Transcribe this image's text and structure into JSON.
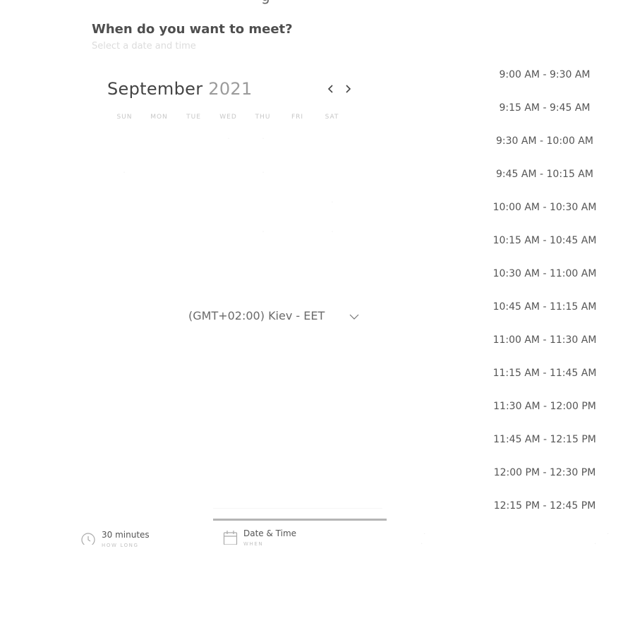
{
  "header": {
    "title": "When do you want to meet?",
    "subtitle": "Select a date and time"
  },
  "calendar": {
    "month": "September",
    "year": "2021",
    "weekdays": [
      "SUN",
      "MON",
      "TUE",
      "WED",
      "THU",
      "FRI",
      "SAT"
    ]
  },
  "timezone": {
    "label": "(GMT+02:00) Kiev - EET"
  },
  "slots": [
    "9:00 AM - 9:30 AM",
    "9:15 AM - 9:45 AM",
    "9:30 AM - 10:00 AM",
    "9:45 AM - 10:15 AM",
    "10:00 AM - 10:30 AM",
    "10:15 AM - 10:45 AM",
    "10:30 AM - 11:00 AM",
    "10:45 AM - 11:15 AM",
    "11:00 AM - 11:30 AM",
    "11:15 AM - 11:45 AM",
    "11:30 AM - 12:00 PM",
    "11:45 AM - 12:15 PM",
    "12:00 PM - 12:30 PM",
    "12:15 PM - 12:45 PM"
  ],
  "steps": {
    "duration": {
      "title": "30 minutes",
      "sub": "HOW LONG"
    },
    "date": {
      "title": "Date & Time",
      "sub": "WHEN"
    }
  },
  "icons": {
    "prev": "chevron-left-icon",
    "next": "chevron-right-icon",
    "timezone_toggle": "chevron-down-icon",
    "duration": "clock-icon",
    "date": "calendar-icon"
  }
}
